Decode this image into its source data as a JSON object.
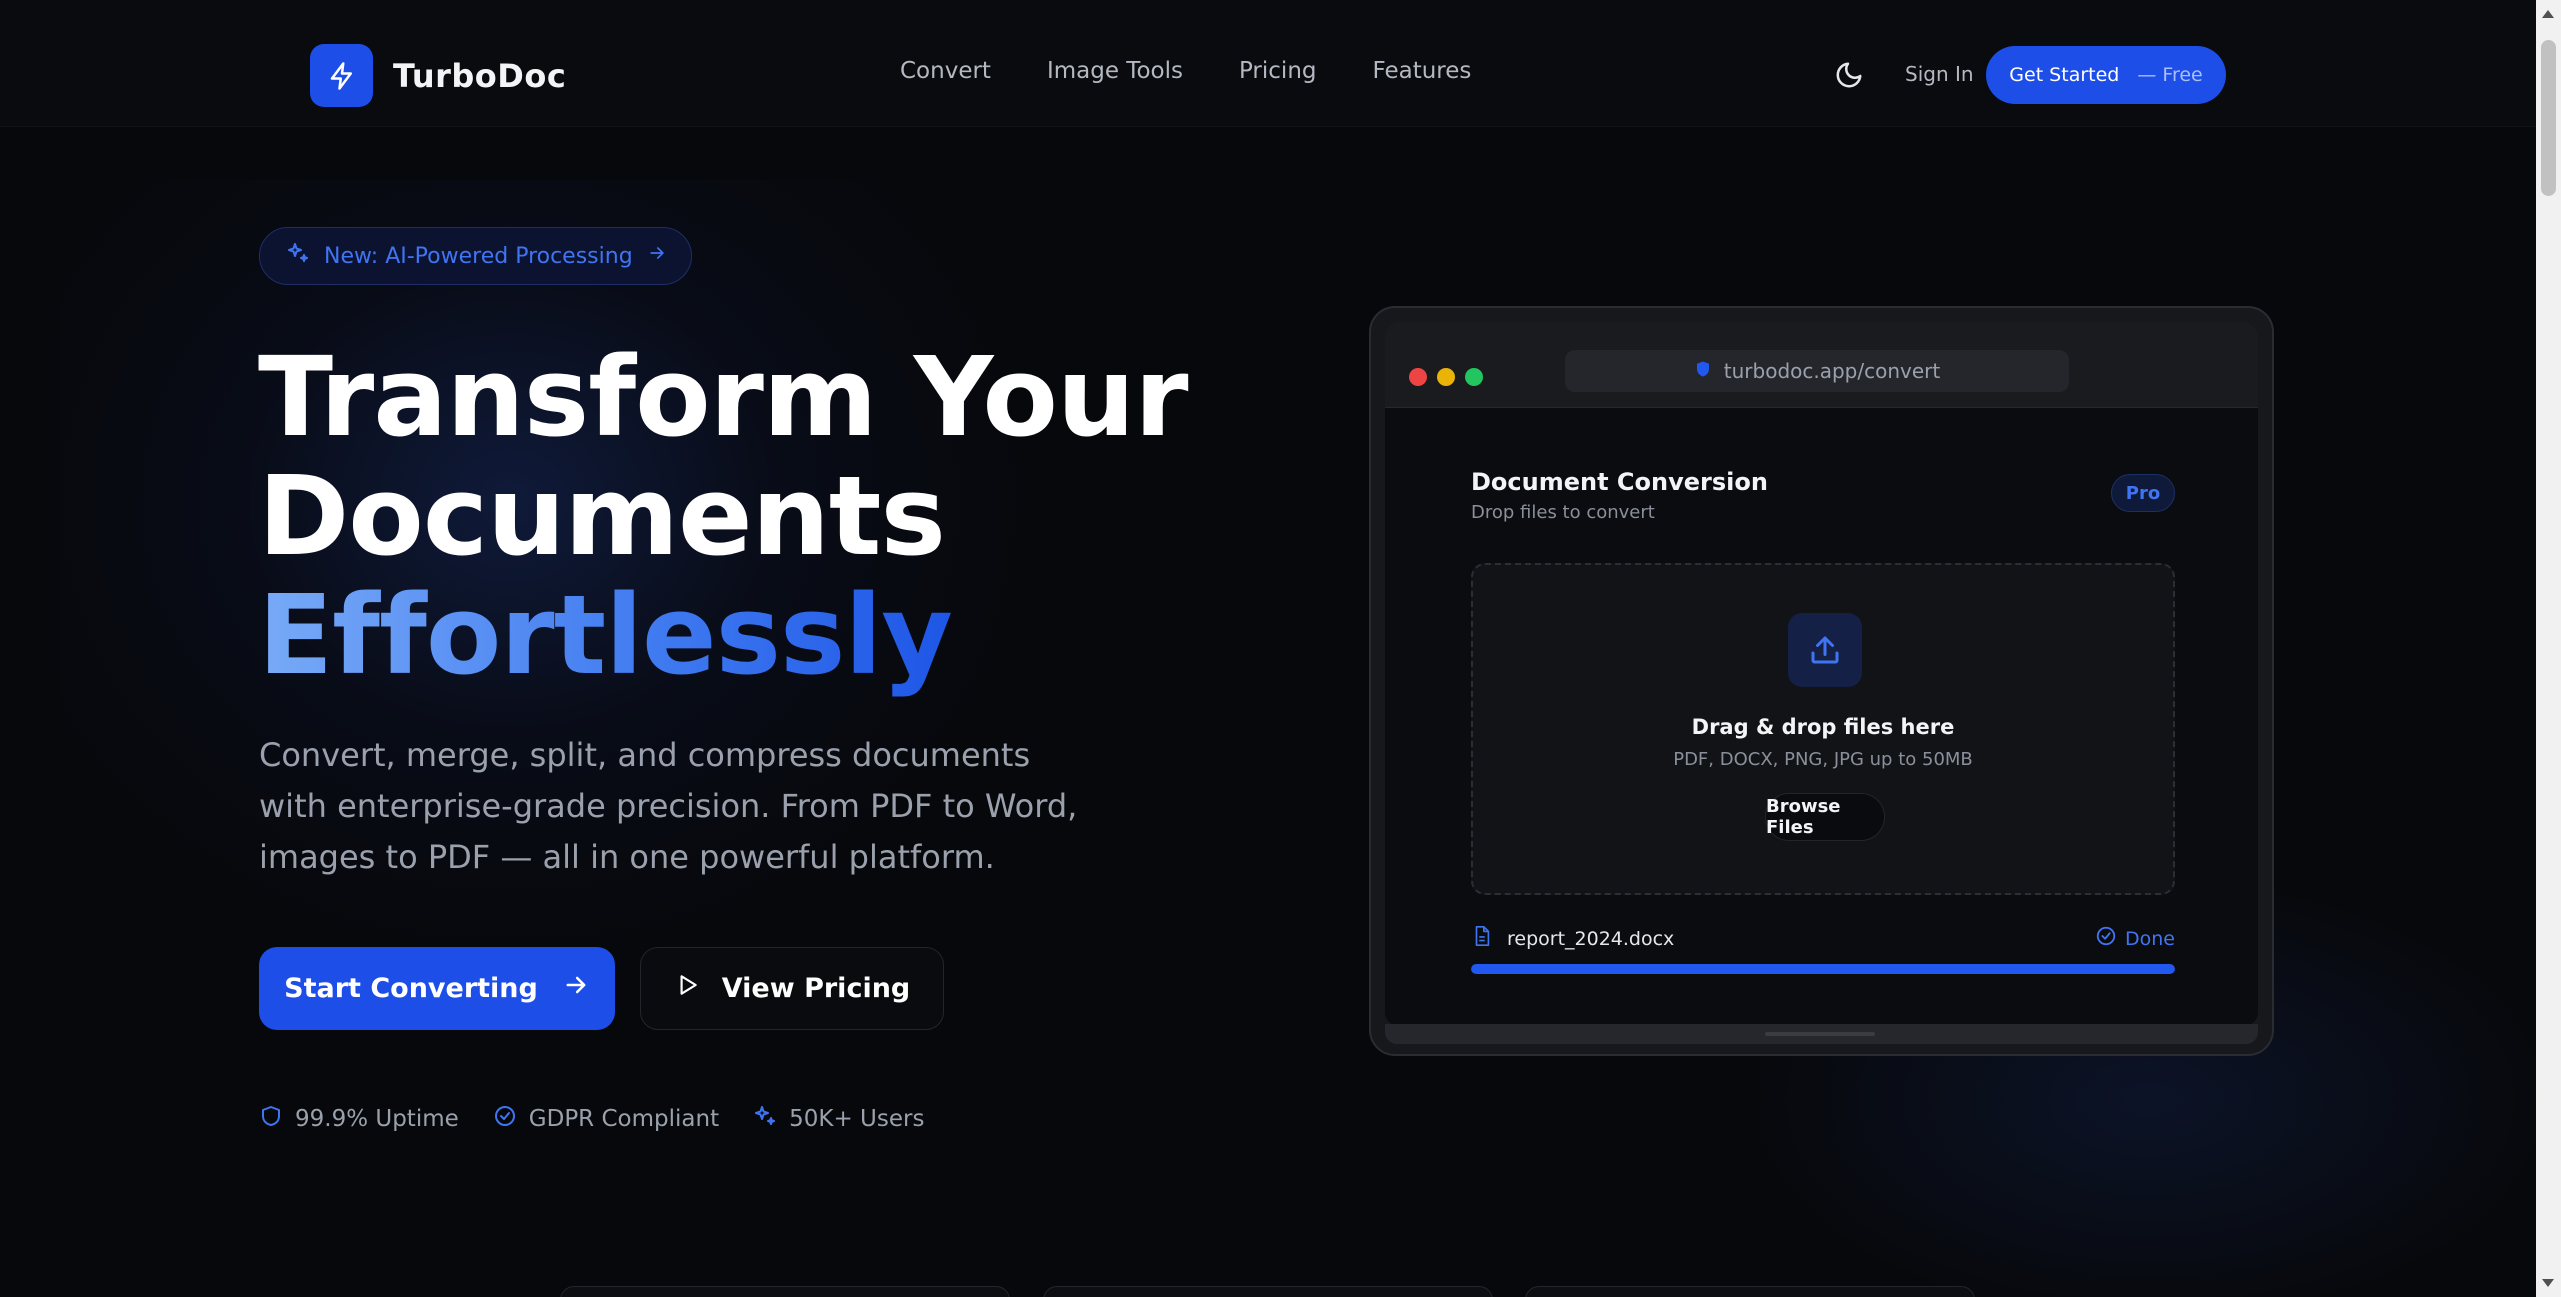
{
  "brand": {
    "name": "TurboDoc",
    "logo_icon": "bolt-icon"
  },
  "nav": {
    "items": [
      "Convert",
      "Image Tools",
      "Pricing",
      "Features"
    ]
  },
  "header": {
    "theme_icon": "moon-icon",
    "sign_in": "Sign In",
    "cta_label": "Get Started",
    "cta_suffix": "— Free"
  },
  "hero": {
    "badge": "New: AI-Powered Processing",
    "title_line1": "Transform Your",
    "title_line2": "Documents",
    "title_accent": "Effortlessly",
    "description": "Convert, merge, split, and compress documents with enterprise-grade precision. From PDF to Word, images to PDF — all in one powerful platform.",
    "primary_button": "Start Converting",
    "secondary_button": "View Pricing",
    "trust": [
      {
        "icon": "shield-icon",
        "label": "99.9% Uptime"
      },
      {
        "icon": "check-circle-icon",
        "label": "GDPR Compliant"
      },
      {
        "icon": "sparkles-icon",
        "label": "50K+ Users"
      }
    ]
  },
  "mockup": {
    "url": "turbodoc.app/convert",
    "title": "Document Conversion",
    "subtitle": "Drop files to convert",
    "badge": "Pro",
    "dropzone_title": "Drag & drop files here",
    "dropzone_sub": "PDF, DOCX, PNG, JPG up to 50MB",
    "browse_label": "Browse Files",
    "file_name": "report_2024.docx",
    "file_status": "Done",
    "progress": 1.0
  },
  "colors": {
    "accent": "#1d4ee8",
    "accent_text": "#3f74f3",
    "background": "#07080b"
  }
}
